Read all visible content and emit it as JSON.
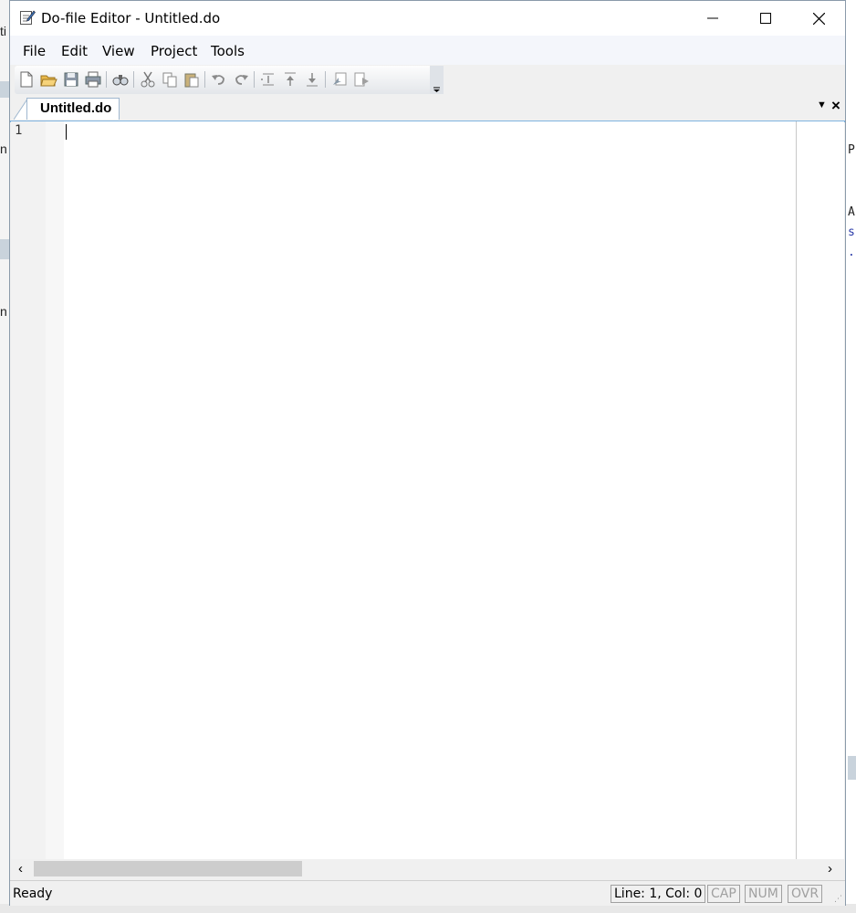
{
  "window": {
    "title": "Do-file Editor - Untitled.do"
  },
  "menu": {
    "items": [
      "File",
      "Edit",
      "View",
      "Project",
      "Tools"
    ]
  },
  "toolbar": {
    "buttons": [
      "new-icon",
      "open-icon",
      "save-icon",
      "print-icon",
      "find-icon",
      "cut-icon",
      "copy-icon",
      "paste-icon",
      "undo-icon",
      "redo-icon",
      "shift-indent-icon",
      "shift-up-icon",
      "shift-down-icon",
      "execute-selection-icon",
      "run-icon"
    ]
  },
  "tabs": [
    {
      "label": "Untitled.do",
      "active": true
    }
  ],
  "editor": {
    "line_numbers": [
      "1"
    ],
    "content": ""
  },
  "status": {
    "text": "Ready",
    "position": "Line: 1, Col: 0",
    "caps": "CAP",
    "num": "NUM",
    "ovr": "OVR"
  },
  "background": {
    "left_fragments": [
      "ti",
      "n",
      "n"
    ],
    "right_fragments": [
      "P",
      "A",
      "s",
      "."
    ]
  },
  "colors": {
    "tab_accent": "#7fb3df",
    "window_border": "#8a9aaa"
  }
}
